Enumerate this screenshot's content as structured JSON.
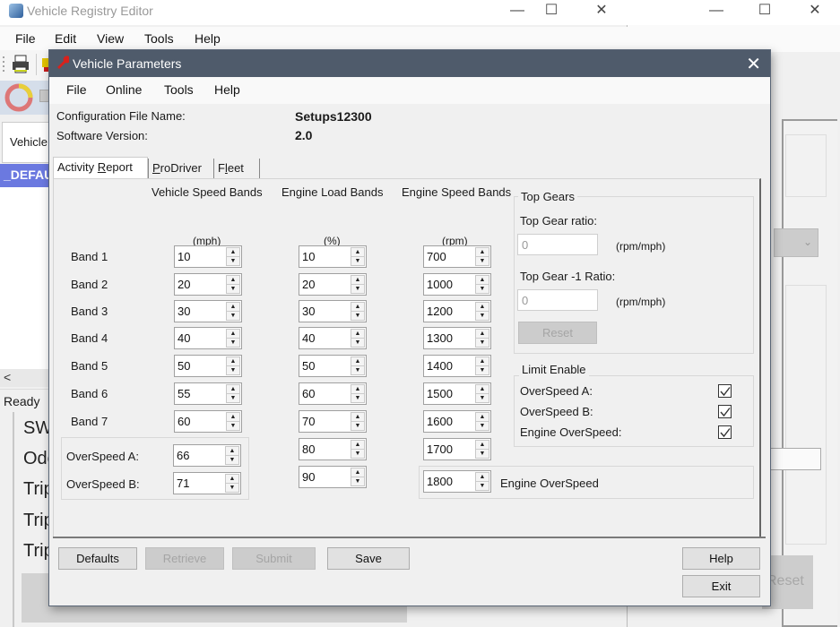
{
  "back_window_right": {
    "caption_buttons": {
      "minimize": "—",
      "maximize": "☐",
      "close": "✕"
    },
    "combo_chevron": "⌄",
    "reset_label": "Reset"
  },
  "back_window": {
    "title": "Vehicle Registry Editor",
    "caption_buttons": {
      "minimize": "—",
      "maximize": "☐",
      "close": "✕"
    },
    "menu": [
      "File",
      "Edit",
      "View",
      "Tools",
      "Help"
    ],
    "vehicle_label": "Vehicle",
    "selected_item": "_DEFAU",
    "scroll_left": "<",
    "status": "Ready",
    "detail_labels": [
      "SW",
      "Odo",
      "Trip",
      "Trip",
      "Trip"
    ]
  },
  "dialog": {
    "title": "Vehicle Parameters",
    "close": "✕",
    "menu": [
      "File",
      "Online",
      "Tools",
      "Help"
    ],
    "config_file_label": "Configuration File Name:",
    "config_file_value": "Setups12300",
    "software_version_label": "Software Version:",
    "software_version_value": "2.0",
    "tabs": [
      {
        "label_pre": "Activity ",
        "label_ul": "R",
        "label_post": "eport",
        "active": true
      },
      {
        "label_pre": "",
        "label_ul": "P",
        "label_post": "roDriver",
        "active": false
      },
      {
        "label_pre": "F",
        "label_ul": "l",
        "label_post": "eet",
        "active": false
      }
    ],
    "activity_report": {
      "headers": {
        "vehicle_speed": "Vehicle Speed Bands",
        "engine_load": "Engine Load Bands",
        "engine_speed": "Engine Speed Bands"
      },
      "units": {
        "vehicle_speed": "(mph)",
        "engine_load": "(%)",
        "engine_speed": "(rpm)"
      },
      "band_labels": [
        "Band 1",
        "Band 2",
        "Band 3",
        "Band 4",
        "Band 5",
        "Band 6",
        "Band 7"
      ],
      "vehicle_speed_values": [
        "10",
        "20",
        "30",
        "40",
        "50",
        "55",
        "60"
      ],
      "engine_load_values": [
        "10",
        "20",
        "30",
        "40",
        "50",
        "60",
        "70",
        "80",
        "90"
      ],
      "engine_speed_values": [
        "700",
        "1000",
        "1200",
        "1300",
        "1400",
        "1500",
        "1600",
        "1700"
      ],
      "overspeed": {
        "a_label": "OverSpeed A:",
        "a_value": "66",
        "b_label": "OverSpeed B:",
        "b_value": "71"
      },
      "engine_overspeed": {
        "value": "1800",
        "label": "Engine OverSpeed"
      },
      "top_gears": {
        "title": "Top Gears",
        "ratio_label": "Top Gear ratio:",
        "ratio_value": "0",
        "ratio_unit": "(rpm/mph)",
        "ratio1_label": "Top Gear -1 Ratio:",
        "ratio1_value": "0",
        "ratio1_unit": "(rpm/mph)",
        "reset_label": "Reset"
      },
      "limit_enable": {
        "title": "Limit Enable",
        "items": [
          {
            "label": "OverSpeed A:",
            "checked": true
          },
          {
            "label": "OverSpeed B:",
            "checked": true
          },
          {
            "label": "Engine OverSpeed:",
            "checked": true
          }
        ]
      }
    },
    "buttons": {
      "defaults": "Defaults",
      "retrieve": "Retrieve",
      "submit": "Submit",
      "save": "Save",
      "help": "Help",
      "exit": "Exit"
    }
  }
}
